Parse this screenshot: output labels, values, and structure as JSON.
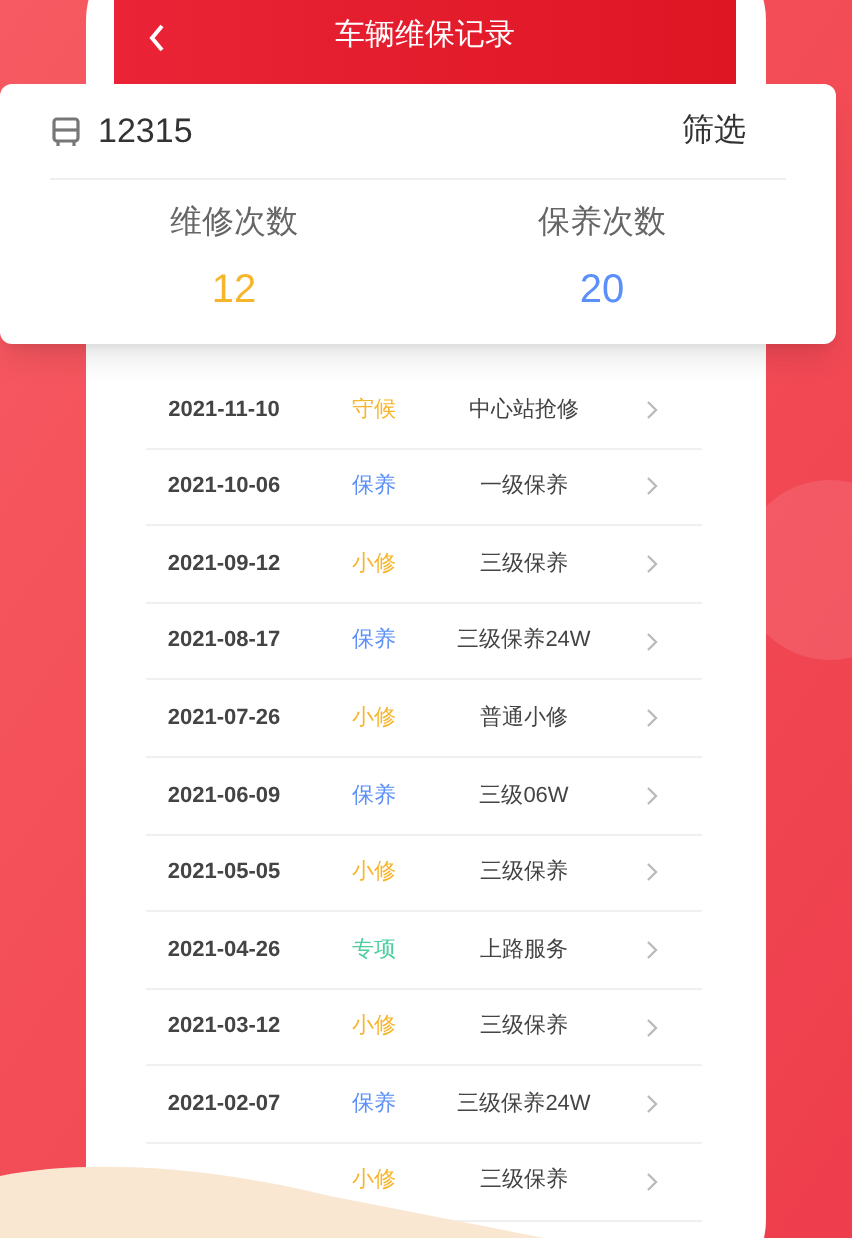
{
  "header": {
    "title": "车辆维保记录"
  },
  "summary": {
    "plate": "12315",
    "filter": "筛选",
    "stats": [
      {
        "label": "维修次数",
        "value": "12",
        "color": "#f7b52c"
      },
      {
        "label": "保养次数",
        "value": "20",
        "color": "#5b8ff9"
      }
    ]
  },
  "records": [
    {
      "date": "2021-11-10",
      "type": "守候",
      "color": "#f7b52c",
      "content": "中心站抢修"
    },
    {
      "date": "2021-10-06",
      "type": "保养",
      "color": "#5b8ff9",
      "content": "一级保养"
    },
    {
      "date": "2021-09-12",
      "type": "小修",
      "color": "#f7b52c",
      "content": "三级保养"
    },
    {
      "date": "2021-08-17",
      "type": "保养",
      "color": "#5b8ff9",
      "content": "三级保养24W"
    },
    {
      "date": "2021-07-26",
      "type": "小修",
      "color": "#f7b52c",
      "content": "普通小修"
    },
    {
      "date": "2021-06-09",
      "type": "保养",
      "color": "#5b8ff9",
      "content": "三级06W"
    },
    {
      "date": "2021-05-05",
      "type": "小修",
      "color": "#f7b52c",
      "content": "三级保养"
    },
    {
      "date": "2021-04-26",
      "type": "专项",
      "color": "#4ccf9f",
      "content": "上路服务"
    },
    {
      "date": "2021-03-12",
      "type": "小修",
      "color": "#f7b52c",
      "content": "三级保养"
    },
    {
      "date": "2021-02-07",
      "type": "保养",
      "color": "#5b8ff9",
      "content": "三级保养24W"
    },
    {
      "type": "小修",
      "color": "#f7b52c",
      "content": "三级保养"
    }
  ]
}
